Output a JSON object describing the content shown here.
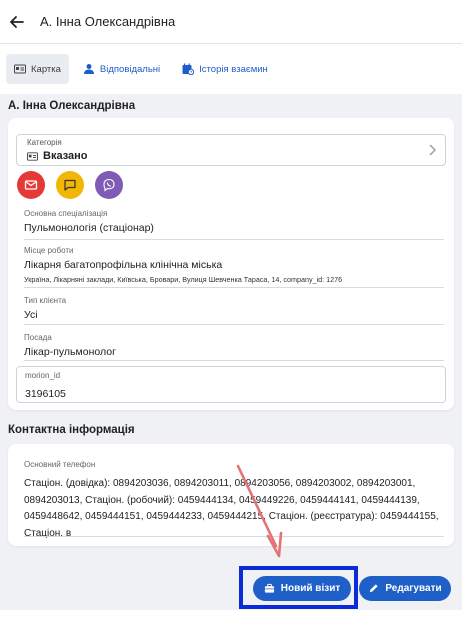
{
  "header": {
    "title": "А. Інна Олександрівна"
  },
  "tabs": [
    {
      "label": "Картка",
      "icon": "card-icon",
      "active": true
    },
    {
      "label": "Відповідальні",
      "icon": "person-icon",
      "active": false
    },
    {
      "label": "Історія взаємин",
      "icon": "history-icon",
      "active": false
    }
  ],
  "profile": {
    "name": "А. Інна Олександрівна",
    "category_label": "Категорія",
    "category_value": "Вказано",
    "contacts": [
      {
        "icon": "email-icon",
        "color": "#e53935"
      },
      {
        "icon": "chat-icon",
        "color": "#f2b705"
      },
      {
        "icon": "viber-icon",
        "color": "#7f5bb6"
      }
    ],
    "specialization_label": "Основна спеціалізація",
    "specialization_value": "Пульмонологія (стаціонар)",
    "workplace_label": "Місце роботи",
    "workplace_value": "Лікарня багатопрофільна клінічна міська",
    "workplace_address": "Україна, Лікарняні заклади, Київська, Бровари, Вулиця Шевченка Тараса, 14, company_id: 1276",
    "client_type_label": "Тип клієнта",
    "client_type_value": "Усі",
    "position_label": "Посада",
    "position_value": "Лікар-пульмонолог",
    "morion_label": "morion_id",
    "morion_value": "3196105"
  },
  "contact_info": {
    "heading": "Контактна інформація",
    "phone_label": "Основний телефон",
    "phone_value": "Стаціон. (довідка): 0894203036, 0894203011, 0894203056, 0894203002, 0894203001, 0894203013, Стаціон. (робочий): 0459444134, 0459449226, 0459444141, 0459444139, 0459448642, 0459444151, 0459444233, 0459444215, Стаціон. (реєстратура): 0459444155, Стаціон. в"
  },
  "actions": {
    "new_visit_label": "Новий візит",
    "edit_label": "Редагувати"
  },
  "colors": {
    "accent": "#1f5fc8",
    "highlight_box": "#0b2bd6",
    "annotation_arrow": "#e57373"
  }
}
